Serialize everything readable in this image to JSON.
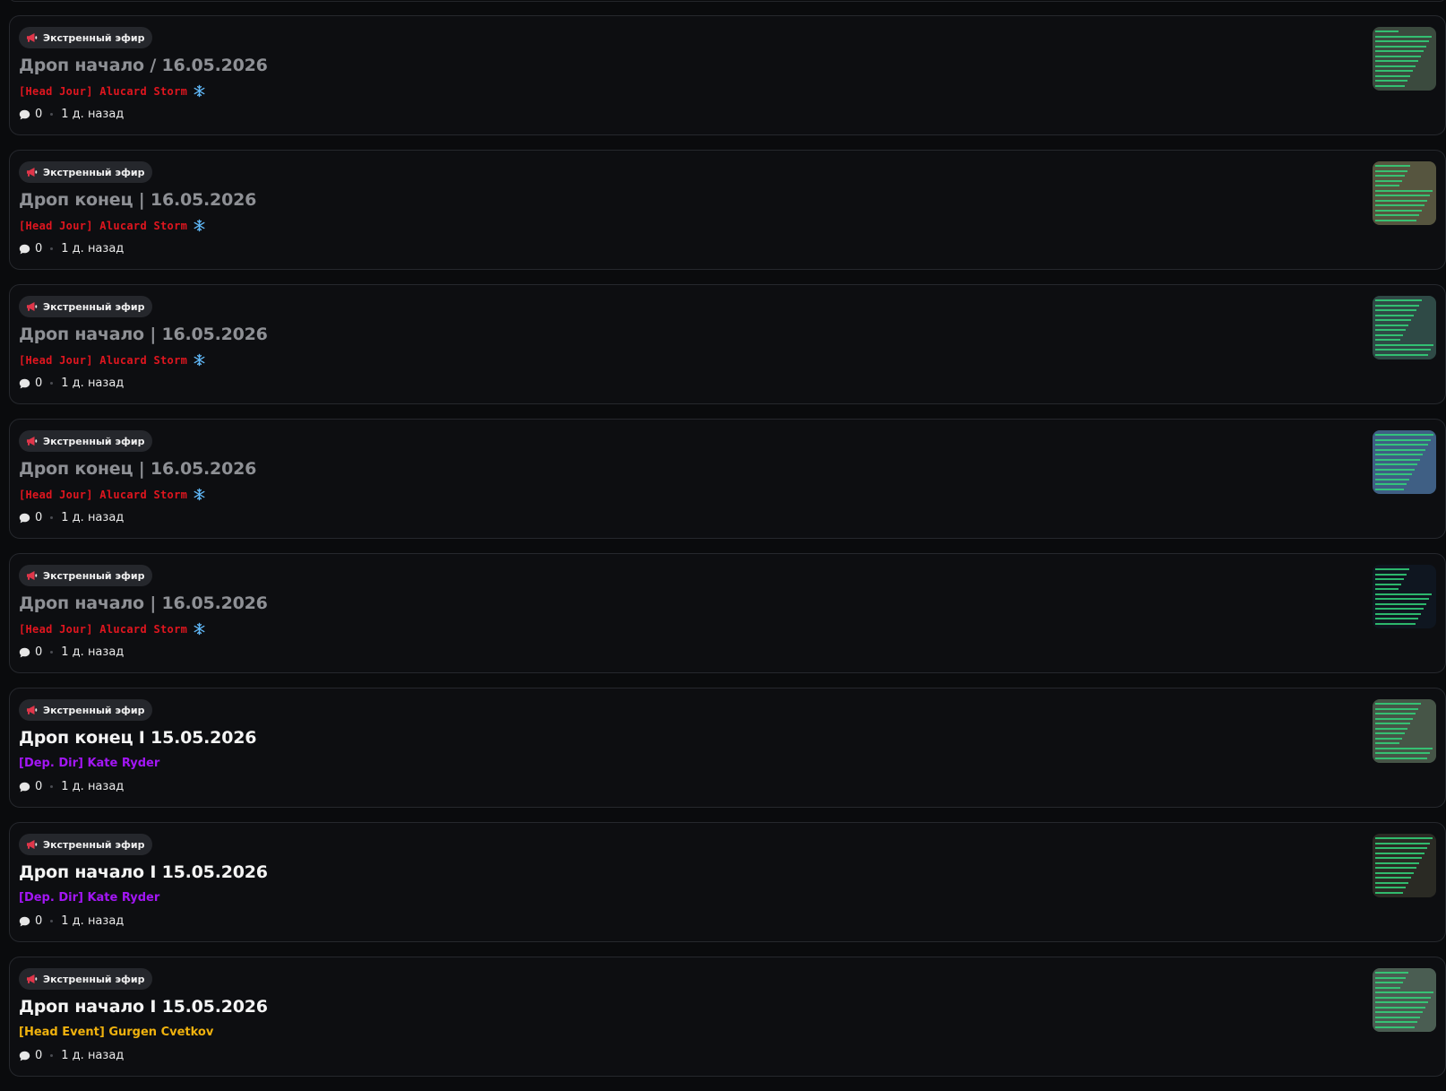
{
  "colors": {
    "badge_icon": "#e0364a",
    "author_red": "#e0161f",
    "author_purple": "#a316f5",
    "author_gold": "#f0b20e",
    "snowflake": "#5fb6f5",
    "title_read": "#8e9095",
    "title_unread": "#f4f4f4"
  },
  "posts": [
    {
      "badge": "Экстренный эфир",
      "badge_icon": "megaphone-icon",
      "title": "Дроп начало / 16.05.2026",
      "read": true,
      "author": "[Head Jour] Alucard Storm",
      "author_color": "#e0161f",
      "author_style": "mono",
      "author_badge_icon": "snowflake-icon",
      "comments": "0",
      "time": "1 д. назад",
      "thumb_bg": "#3b4a3e"
    },
    {
      "badge": "Экстренный эфир",
      "badge_icon": "megaphone-icon",
      "title": "Дроп конец | 16.05.2026",
      "read": true,
      "author": "[Head Jour] Alucard Storm",
      "author_color": "#e0161f",
      "author_style": "mono",
      "author_badge_icon": "snowflake-icon",
      "comments": "0",
      "time": "1 д. назад",
      "thumb_bg": "#56553f"
    },
    {
      "badge": "Экстренный эфир",
      "badge_icon": "megaphone-icon",
      "title": "Дроп начало | 16.05.2026",
      "read": true,
      "author": "[Head Jour] Alucard Storm",
      "author_color": "#e0161f",
      "author_style": "mono",
      "author_badge_icon": "snowflake-icon",
      "comments": "0",
      "time": "1 д. назад",
      "thumb_bg": "#2f4a46"
    },
    {
      "badge": "Экстренный эфир",
      "badge_icon": "megaphone-icon",
      "title": "Дроп конец | 16.05.2026",
      "read": true,
      "author": "[Head Jour] Alucard Storm",
      "author_color": "#e0161f",
      "author_style": "mono",
      "author_badge_icon": "snowflake-icon",
      "comments": "0",
      "time": "1 д. назад",
      "thumb_bg": "#3f5f84"
    },
    {
      "badge": "Экстренный эфир",
      "badge_icon": "megaphone-icon",
      "title": "Дроп начало | 16.05.2026",
      "read": true,
      "author": "[Head Jour] Alucard Storm",
      "author_color": "#e0161f",
      "author_style": "mono",
      "author_badge_icon": "snowflake-icon",
      "comments": "0",
      "time": "1 д. назад",
      "thumb_bg": "#0f1620"
    },
    {
      "badge": "Экстренный эфир",
      "badge_icon": "megaphone-icon",
      "title": "Дроп конец I 15.05.2026",
      "read": false,
      "author": "[Dep. Dir] Kate Ryder",
      "author_color": "#a316f5",
      "author_style": "normal",
      "author_badge_icon": "",
      "comments": "0",
      "time": "1 д. назад",
      "thumb_bg": "#465547"
    },
    {
      "badge": "Экстренный эфир",
      "badge_icon": "megaphone-icon",
      "title": "Дроп начало I 15.05.2026",
      "read": false,
      "author": "[Dep. Dir] Kate Ryder",
      "author_color": "#a316f5",
      "author_style": "normal",
      "author_badge_icon": "",
      "comments": "0",
      "time": "1 д. назад",
      "thumb_bg": "#2a2a24"
    },
    {
      "badge": "Экстренный эфир",
      "badge_icon": "megaphone-icon",
      "title": "Дроп начало I 15.05.2026",
      "read": false,
      "author": "[Head Event] Gurgen Cvetkov",
      "author_color": "#f0b20e",
      "author_style": "normal",
      "author_badge_icon": "",
      "comments": "0",
      "time": "1 д. назад",
      "thumb_bg": "#4a5d52"
    }
  ]
}
